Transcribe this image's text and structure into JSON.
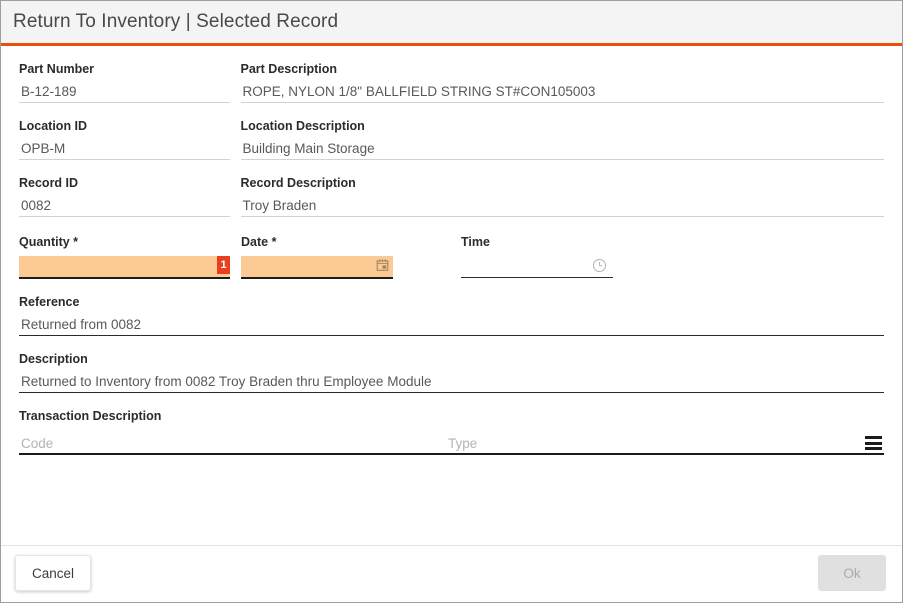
{
  "header": {
    "title": "Return To Inventory | Selected Record",
    "accent_color": "#e8500f",
    "background_color": "#f4f4f4"
  },
  "form": {
    "part_number": {
      "label": "Part Number",
      "value": "B-12-189"
    },
    "part_description": {
      "label": "Part Description",
      "value": "ROPE, NYLON  1/8\" BALLFIELD STRING ST#CON105003"
    },
    "location_id": {
      "label": "Location ID",
      "value": "OPB-M"
    },
    "location_description": {
      "label": "Location Description",
      "value": "Building Main Storage"
    },
    "record_id": {
      "label": "Record ID",
      "value": "0082"
    },
    "record_description": {
      "label": "Record Description",
      "value": "Troy Braden"
    },
    "quantity": {
      "label": "Quantity *",
      "value": "",
      "badge": "1",
      "badge_color": "#e8401f",
      "highlight_color": "#fbcb93"
    },
    "date": {
      "label": "Date *",
      "value": "",
      "icon": "calendar-icon",
      "highlight_color": "#fbcb93"
    },
    "time": {
      "label": "Time",
      "value": "",
      "icon": "clock-icon"
    },
    "reference": {
      "label": "Reference",
      "value": "Returned from 0082"
    },
    "description": {
      "label": "Description",
      "value": "Returned to Inventory from 0082 Troy Braden thru Employee Module"
    },
    "transaction_description": {
      "label": "Transaction Description",
      "code_placeholder": "Code",
      "type_placeholder": "Type",
      "menu_icon": "hamburger-menu-icon"
    }
  },
  "footer": {
    "cancel_label": "Cancel",
    "ok_label": "Ok"
  }
}
